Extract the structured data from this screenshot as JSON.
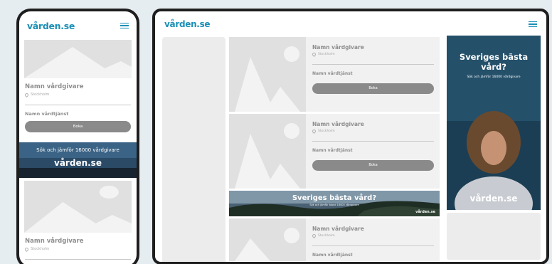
{
  "brand": {
    "logo": "vården.se",
    "accent": "#1b8fb5"
  },
  "card": {
    "name": "Namn vårdgivare",
    "location": "Stockholm",
    "service": "Namn vårdtjänst",
    "book": "Boka"
  },
  "phone_banner": {
    "text": "Sök och jämför 16000 vårdgivare",
    "logo": "vården.se"
  },
  "tablet_banner": {
    "title": "Sveriges bästa vård?",
    "subtitle": "Sök och jämför bland 16000 vårdgivare",
    "logo": "vården.se"
  },
  "tablet_ad": {
    "title": "Sveriges bästa vård?",
    "subtitle": "Sök och jämför 16000 vårdgivare",
    "logo": "vården.se"
  }
}
